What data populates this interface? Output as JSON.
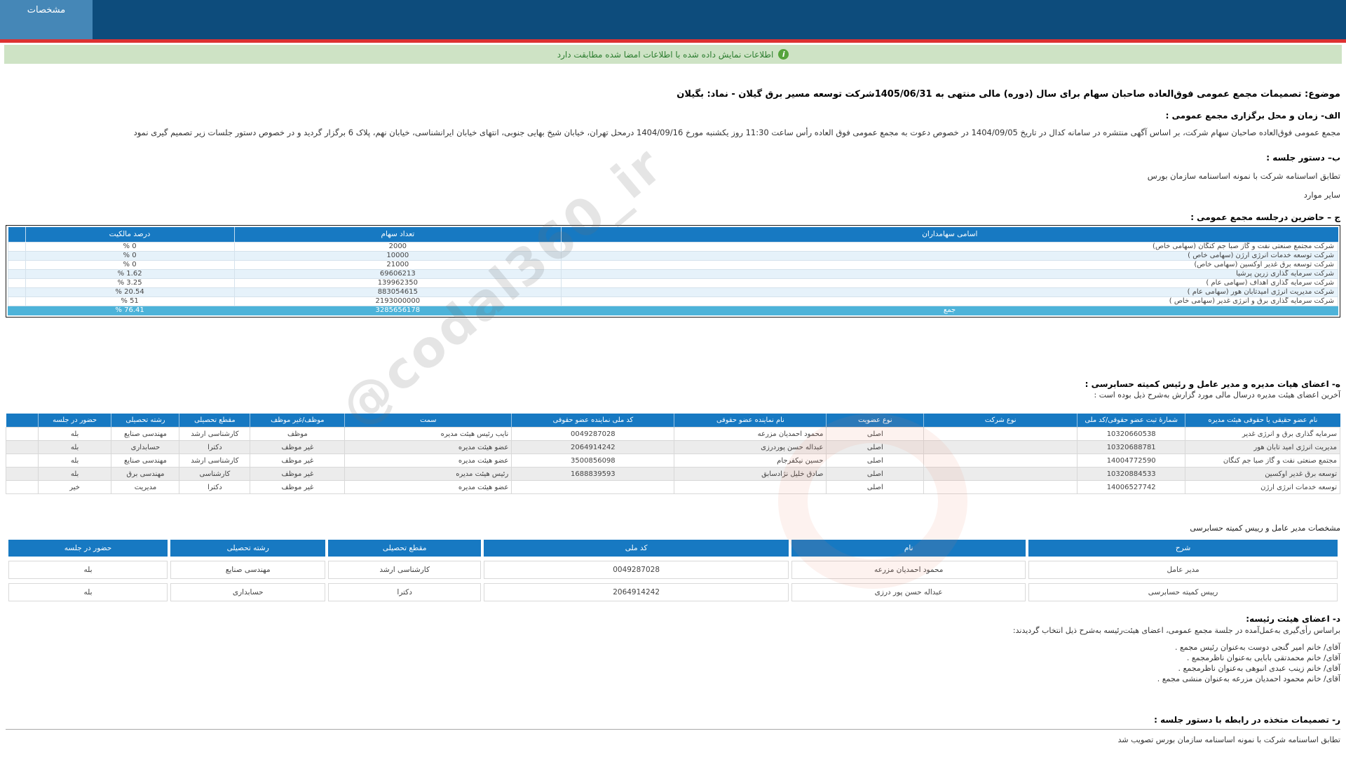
{
  "header": {
    "tab_label": "مشخصات"
  },
  "info_bar": {
    "icon": "info-icon",
    "text": "اطلاعات نمایش داده شده با اطلاعات امضا شده مطابقت دارد"
  },
  "subject": "موضوع: تصمیمات مجمع عمومی فوق‌العاده صاحبان سهام برای سال (دوره) مالی منتهی به 1405/06/31شرکت توسعه مسیر برق گیلان - نماد: بگیلان",
  "sections": {
    "a": {
      "title": "الف- زمان و محل برگزاری مجمع عمومی :",
      "body": "مجمع عمومی فوق‌العاده صاحبان سهام شرکت، بر اساس آگهی منتشره در سامانه کدال در تاریخ 1404/09/05 در خصوص دعوت به مجمع عمومی فوق العاده رأس ساعت 11:30 روز یکشنبه مورخ 1404/09/16 درمحل تهران، خیابان شیخ بهایی جنوبی، انتهای خیابان ایرانشناسی، خیابان نهم، پلاک 6  برگزار گردید و در خصوص دستور جلسات زیر تصمیم گیری نمود"
    },
    "b": {
      "title": "ب– دستور جلسه :",
      "items": [
        "تطابق اساسنامه شرکت با نمونه اساسنامه سازمان بورس",
        "سایر موارد"
      ]
    },
    "c": {
      "title": "ج – حاضرین درجلسه مجمع عمومی :"
    },
    "e": {
      "title": "ه- اعضای هیات مدیره و مدیر عامل و رئیس کمیته حسابرسی :",
      "subtitle": "آخرین اعضای هیئت مدیره درسال مالی مورد گزارش به‌شرح ذیل بوده است :"
    },
    "managers_title": "مشخصات مدیر عامل و رییس کمیته حسابرسی",
    "d": {
      "title": "د- اعضای هیئت رئیسه:",
      "subtitle": "براساس رأی‌گیری به‌عمل‌آمده در جلسة مجمع عمومی، اعضای هیئت‌رئیسه به‌شرح ذیل انتخاب گردیدند:",
      "items": [
        "آقای/ خانم  امیر گنجی دوست  به‌عنوان رئیس مجمع .",
        "آقای/ خانم  محمدتقی بابایی  به‌عنوان ناظرمجمع .",
        "آقای/ خانم  زینب عبدی انبوهی  به‌عنوان ناظرمجمع .",
        "آقای/ خانم  محمود احمدیان مزرعه  به‌عنوان منشی مجمع ."
      ]
    },
    "r": {
      "title": "ر- تصمیمات متخذه در رابطه با دستور جلسه :",
      "body": "تطابق اساسنامه شرکت با نمونه اساسنامه سازمان بورس تصویب شد"
    }
  },
  "shareholders_table": {
    "headers": [
      "اسامی سهامداران",
      "تعداد سهام",
      "درصد مالکیت",
      ""
    ],
    "rows": [
      [
        "شرکت مجتمع صنعتی نفت و گاز صبا جم کنگان (سهامی خاص)",
        "2000",
        "0 %",
        ""
      ],
      [
        "شرکت توسعه خدمات انرژی ارژن (سهامی خاص )",
        "10000",
        "0 %",
        ""
      ],
      [
        "شرکت توسعه برق غدیر اوکسین (سهامی خاص)",
        "21000",
        "0 %",
        ""
      ],
      [
        "شرکت سرمایه گذاری زرین پرشیا",
        "69606213",
        "1.62 %",
        ""
      ],
      [
        "شرکت سرمایه گذاری اهداف (سهامی عام )",
        "139962350",
        "3.25 %",
        ""
      ],
      [
        "شرکت مدیریت انرژی امیدتابان هور (سهامی عام )",
        "883054615",
        "20.54 %",
        ""
      ],
      [
        "شرکت سرمایه گذاری برق و انرژی غدیر (سهامی خاص )",
        "2193000000",
        "51 %",
        ""
      ],
      [
        "جمع",
        "3285656178",
        "76.41 %",
        ""
      ]
    ]
  },
  "board_table": {
    "headers": [
      "نام عضو حقیقی یا حقوقی هیئت مدیره",
      "شمارهٔ ثبت عضو حقوقی/کد ملی",
      "نوع شرکت",
      "نوع عضویت",
      "نام نماینده عضو حقوقی",
      "کد ملی نماینده عضو حقوقی",
      "سمت",
      "موظف/غیر موظف",
      "مقطع تحصیلی",
      "رشته تحصیلی",
      "حضور در جلسه",
      ""
    ],
    "rows": [
      [
        "سرمایه گذاری برق و انرژی غدیر",
        "10320660538",
        "",
        "اصلی",
        "محمود احمدیان مزرعه",
        "0049287028",
        "نایب رئیس هیئت مدیره",
        "موظف",
        "کارشناسی ارشد",
        "مهندسی صنایع",
        "بله",
        ""
      ],
      [
        "مدیریت انرژی امید تابان هور",
        "10320688781",
        "",
        "اصلی",
        "عبداله حسن پوردرزی",
        "2064914242",
        "عضو هیئت مدیره",
        "غیر موظف",
        "دکترا",
        "حسابداری",
        "بله",
        ""
      ],
      [
        "مجتمع صنعتی نفت و گاز صبا جم کنگان",
        "14004772590",
        "",
        "اصلی",
        "حسین نیکفرجام",
        "3500856098",
        "عضو هیئت مدیره",
        "غیر موظف",
        "کارشناسی ارشد",
        "مهندسی صنایع",
        "بله",
        ""
      ],
      [
        "توسعه برق غدیر اوکسین",
        "10320884533",
        "",
        "اصلی",
        "صادق خلیل نژادسابق",
        "1688839593",
        "رئیس هیئت مدیره",
        "غیر موظف",
        "کارشناسی",
        "مهندسی برق",
        "بله",
        ""
      ],
      [
        "توسعه خدمات انرژی ارژن",
        "14006527742",
        "",
        "اصلی",
        "",
        "",
        "عضو هیئت مدیره",
        "غیر موظف",
        "دکترا",
        "مدیریت",
        "خیر",
        ""
      ]
    ]
  },
  "managers_table": {
    "headers": [
      "شرح",
      "نام",
      "کد ملی",
      "مقطع تحصیلی",
      "رشته تحصیلی",
      "حضور در جلسه"
    ],
    "rows": [
      [
        "مدیر عامل",
        "محمود احمدیان مزرعه",
        "0049287028",
        "کارشناسی ارشد",
        "مهندسی صنایع",
        "بله"
      ],
      [
        "رییس کمیته حسابرسی",
        "عبداله حسن پور درزی",
        "2064914242",
        "دکترا",
        "حسابداری",
        "بله"
      ]
    ]
  },
  "watermark": {
    "text": "@codal360_ir"
  },
  "colors": {
    "navbar": "#0d4c7c",
    "tab": "#4587b7",
    "red_line": "#dd3232",
    "info_bg": "#cee3c5",
    "info_text": "#2c7d2f",
    "table_header": "#1779c2",
    "alt_row_blue": "#e6f2fa",
    "alt_row_gray": "#ececec",
    "total_row": "#4db3d9"
  }
}
